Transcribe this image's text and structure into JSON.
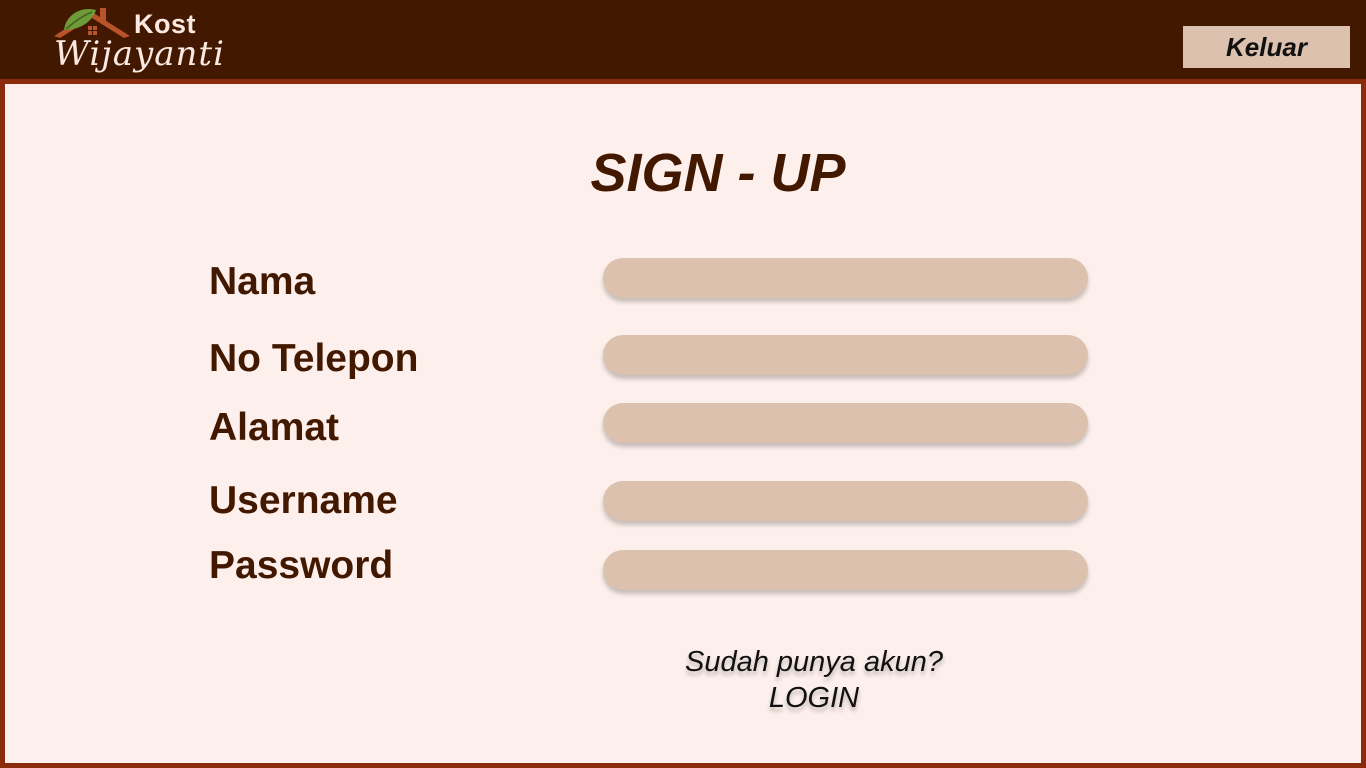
{
  "header": {
    "logo": {
      "top_text": "Kost",
      "main_text": "Wijayanti",
      "icon": "house-roof-leaf-icon"
    },
    "logout_label": "Keluar"
  },
  "form": {
    "title": "SIGN - UP",
    "fields": [
      {
        "label": "Nama",
        "value": ""
      },
      {
        "label": "No Telepon",
        "value": ""
      },
      {
        "label": "Alamat",
        "value": ""
      },
      {
        "label": "Username",
        "value": ""
      },
      {
        "label": "Password",
        "value": ""
      }
    ],
    "login_question": "Sudah punya akun?",
    "login_link": "LOGIN"
  },
  "colors": {
    "header_bg": "#421800",
    "panel_bg": "#fdf0ec",
    "panel_border": "#8a2b0c",
    "input_bg": "#dbc1ae",
    "label_text": "#421800"
  }
}
